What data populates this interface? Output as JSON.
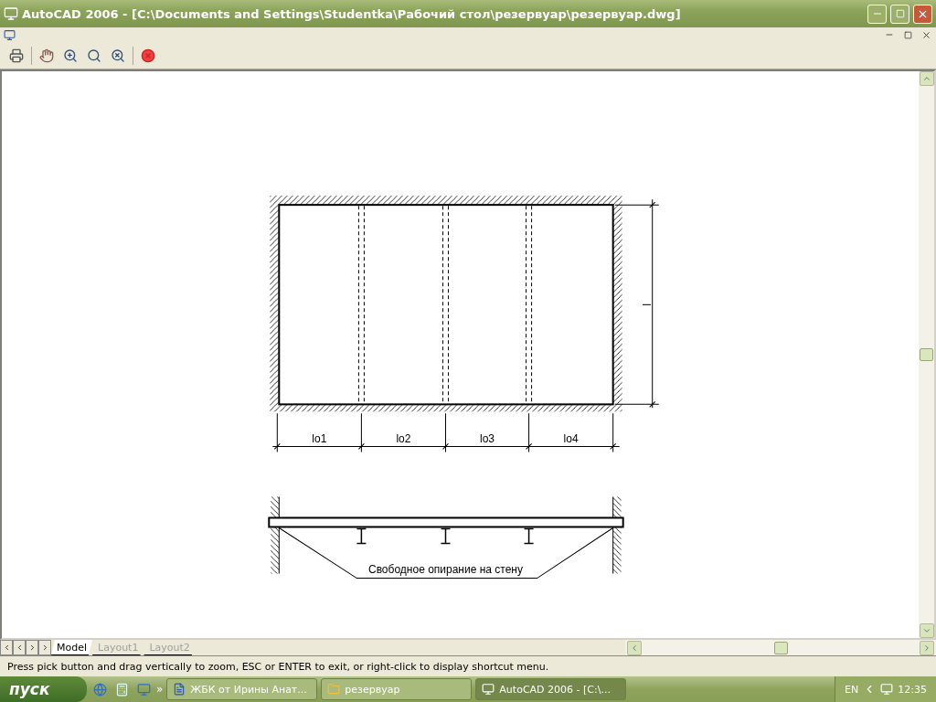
{
  "window": {
    "title": "AutoCAD 2006 - [C:\\Documents and Settings\\Studentka\\Рабочий стол\\резервуар\\резервуар.dwg]"
  },
  "drawing": {
    "plan_spans": [
      "lo1",
      "lo2",
      "lo3",
      "lo4"
    ],
    "height_label": "l",
    "section_note": "Свободное опирание на стену"
  },
  "layout_tabs": [
    {
      "label": "Model",
      "selected": true
    },
    {
      "label": "Layout1",
      "selected": false
    },
    {
      "label": "Layout2",
      "selected": false
    }
  ],
  "status_bar": "Press pick button and drag vertically to zoom, ESC or ENTER to exit, or right-click to display shortcut menu.",
  "taskbar": {
    "start": "пуск",
    "quick_launch_more": "»",
    "tasks": [
      {
        "label": "ЖБК от Ирины Анат...",
        "selected": false,
        "kind": "word"
      },
      {
        "label": "резервуар",
        "selected": false,
        "kind": "folder"
      },
      {
        "label": "AutoCAD 2006 - [C:\\...",
        "selected": true,
        "kind": "autocad"
      }
    ],
    "language": "EN",
    "clock": "12:35"
  }
}
